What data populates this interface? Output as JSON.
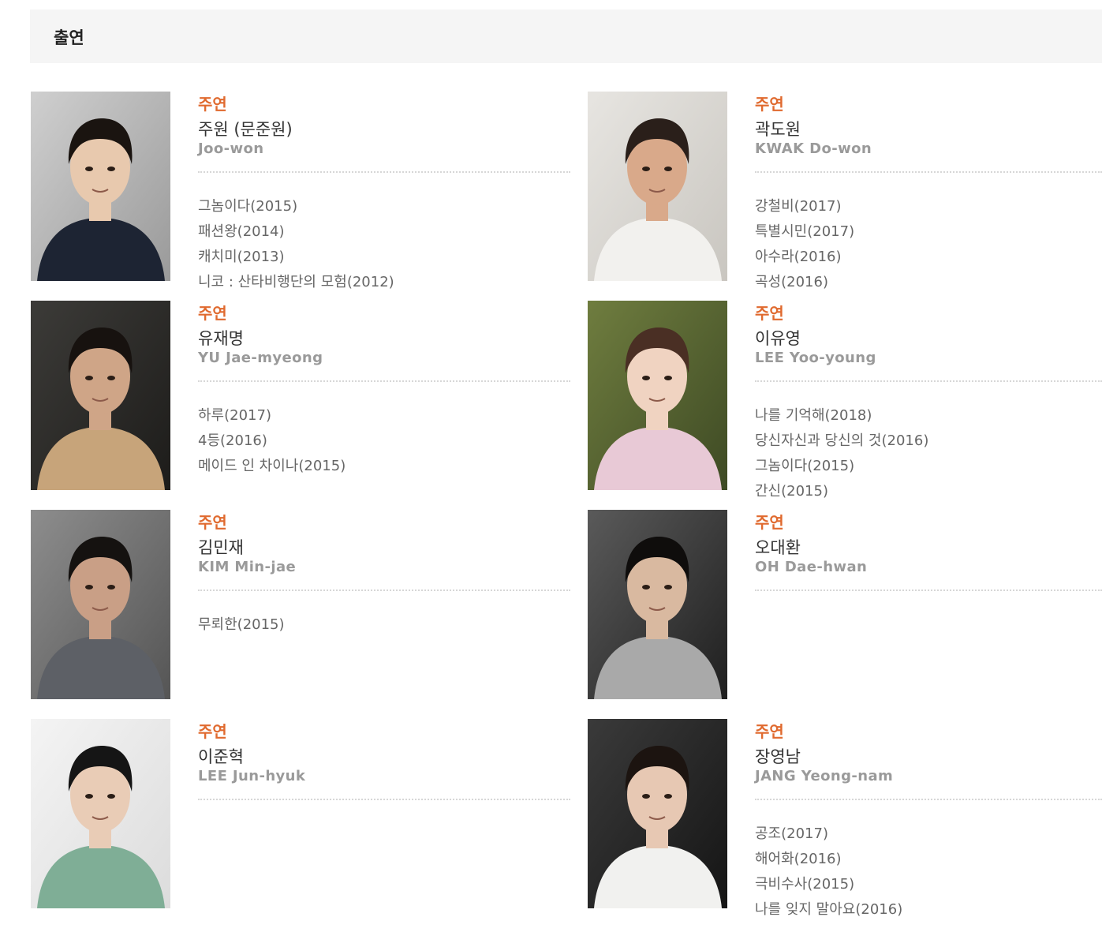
{
  "section": {
    "title": "출연"
  },
  "cast": [
    {
      "role": "주연",
      "name_ko": "주원 (문준원)",
      "name_en": "Joo-won",
      "films": [
        "그놈이다(2015)",
        "패션왕(2014)",
        "캐치미(2013)",
        "니코 : 산타비행단의 모험(2012)"
      ]
    },
    {
      "role": "주연",
      "name_ko": "곽도원",
      "name_en": "KWAK Do-won",
      "films": [
        "강철비(2017)",
        "특별시민(2017)",
        "아수라(2016)",
        "곡성(2016)"
      ]
    },
    {
      "role": "주연",
      "name_ko": "유재명",
      "name_en": "YU Jae-myeong",
      "films": [
        "하루(2017)",
        "4등(2016)",
        "메이드 인 차이나(2015)"
      ]
    },
    {
      "role": "주연",
      "name_ko": "이유영",
      "name_en": "LEE Yoo-young",
      "films": [
        "나를 기억해(2018)",
        "당신자신과 당신의 것(2016)",
        "그놈이다(2015)",
        "간신(2015)"
      ]
    },
    {
      "role": "주연",
      "name_ko": "김민재",
      "name_en": "KIM Min-jae",
      "films": [
        "무뢰한(2015)"
      ]
    },
    {
      "role": "주연",
      "name_ko": "오대환",
      "name_en": "OH Dae-hwan",
      "films": []
    },
    {
      "role": "주연",
      "name_ko": "이준혁",
      "name_en": "LEE Jun-hyuk",
      "films": []
    },
    {
      "role": "주연",
      "name_ko": "장영남",
      "name_en": "JANG Yeong-nam",
      "films": [
        "공조(2017)",
        "해어화(2016)",
        "극비수사(2015)",
        "나를 잊지 말아요(2016)"
      ]
    }
  ]
}
